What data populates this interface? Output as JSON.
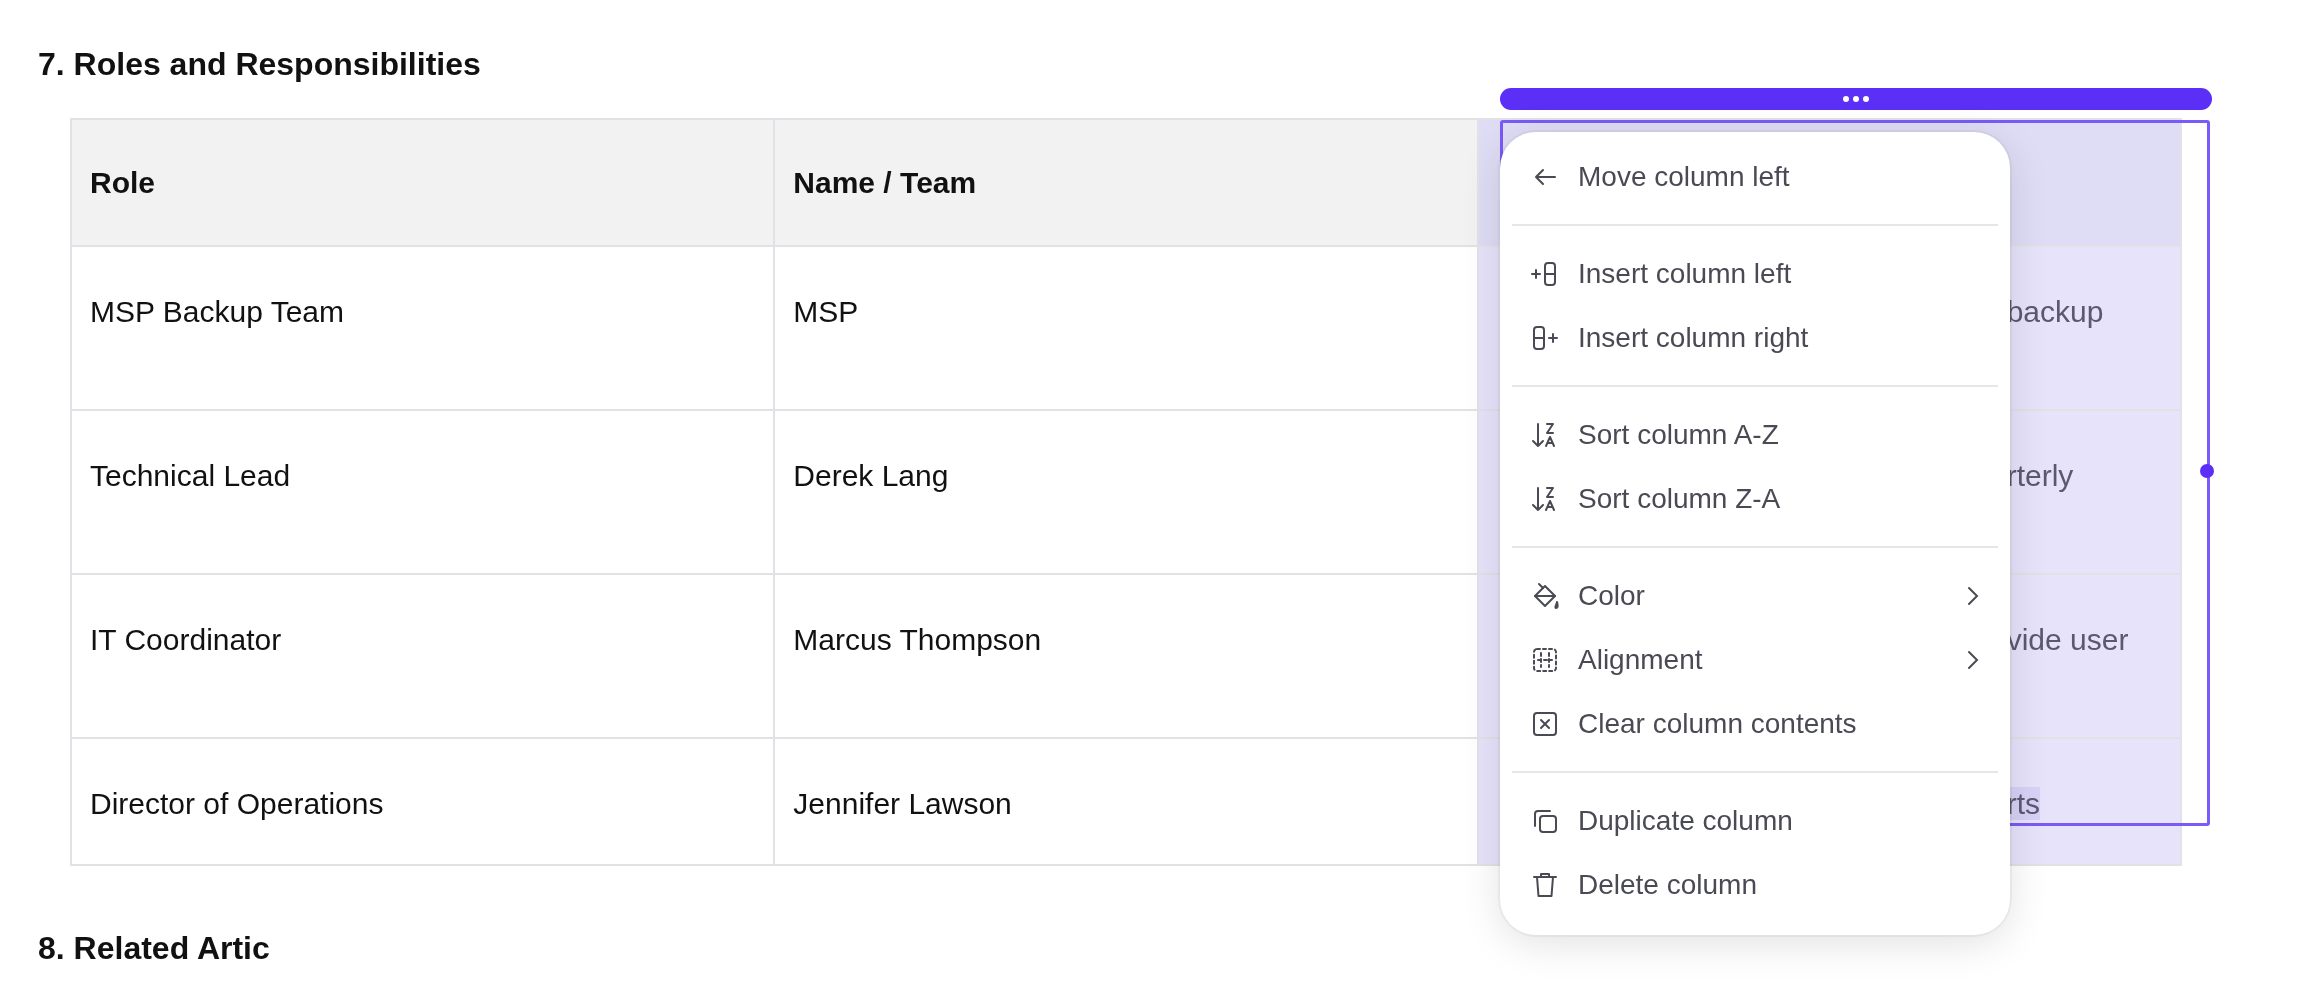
{
  "heading": "7. Roles and Responsibilities",
  "table": {
    "columns": [
      {
        "label": "Role",
        "selected": false
      },
      {
        "label": "Name / Team",
        "selected": false
      },
      {
        "selected": true
      }
    ],
    "rows": [
      {
        "cells": [
          {
            "text": "MSP Backup Team"
          },
          {
            "text": "MSP"
          },
          {
            "text": "backup",
            "highlighted": false
          }
        ]
      },
      {
        "cells": [
          {
            "text": "Technical Lead"
          },
          {
            "text": "Derek Lang"
          },
          {
            "text": "rterly",
            "highlighted": false
          }
        ]
      },
      {
        "cells": [
          {
            "text": "IT Coordinator"
          },
          {
            "text": "Marcus Thompson"
          },
          {
            "text": "vide user",
            "highlighted": false
          }
        ]
      },
      {
        "cells": [
          {
            "text": "Director of Operations"
          },
          {
            "text": "Jennifer Lawson"
          },
          {
            "text": "rts",
            "highlighted": true
          }
        ]
      }
    ]
  },
  "column_menu": {
    "groups": [
      [
        {
          "label": "Move column left",
          "submenu": false
        }
      ],
      [
        {
          "label": "Insert column left",
          "submenu": false
        },
        {
          "label": "Insert column right",
          "submenu": false
        }
      ],
      [
        {
          "label": "Sort column A-Z",
          "submenu": false
        },
        {
          "label": "Sort column Z-A",
          "submenu": false
        }
      ],
      [
        {
          "label": "Color",
          "submenu": true
        },
        {
          "label": "Alignment",
          "submenu": true
        },
        {
          "label": "Clear column contents",
          "submenu": false
        }
      ],
      [
        {
          "label": "Duplicate column",
          "submenu": false
        },
        {
          "label": "Delete column",
          "submenu": false
        }
      ]
    ]
  },
  "next_heading": "8. Related Artic"
}
